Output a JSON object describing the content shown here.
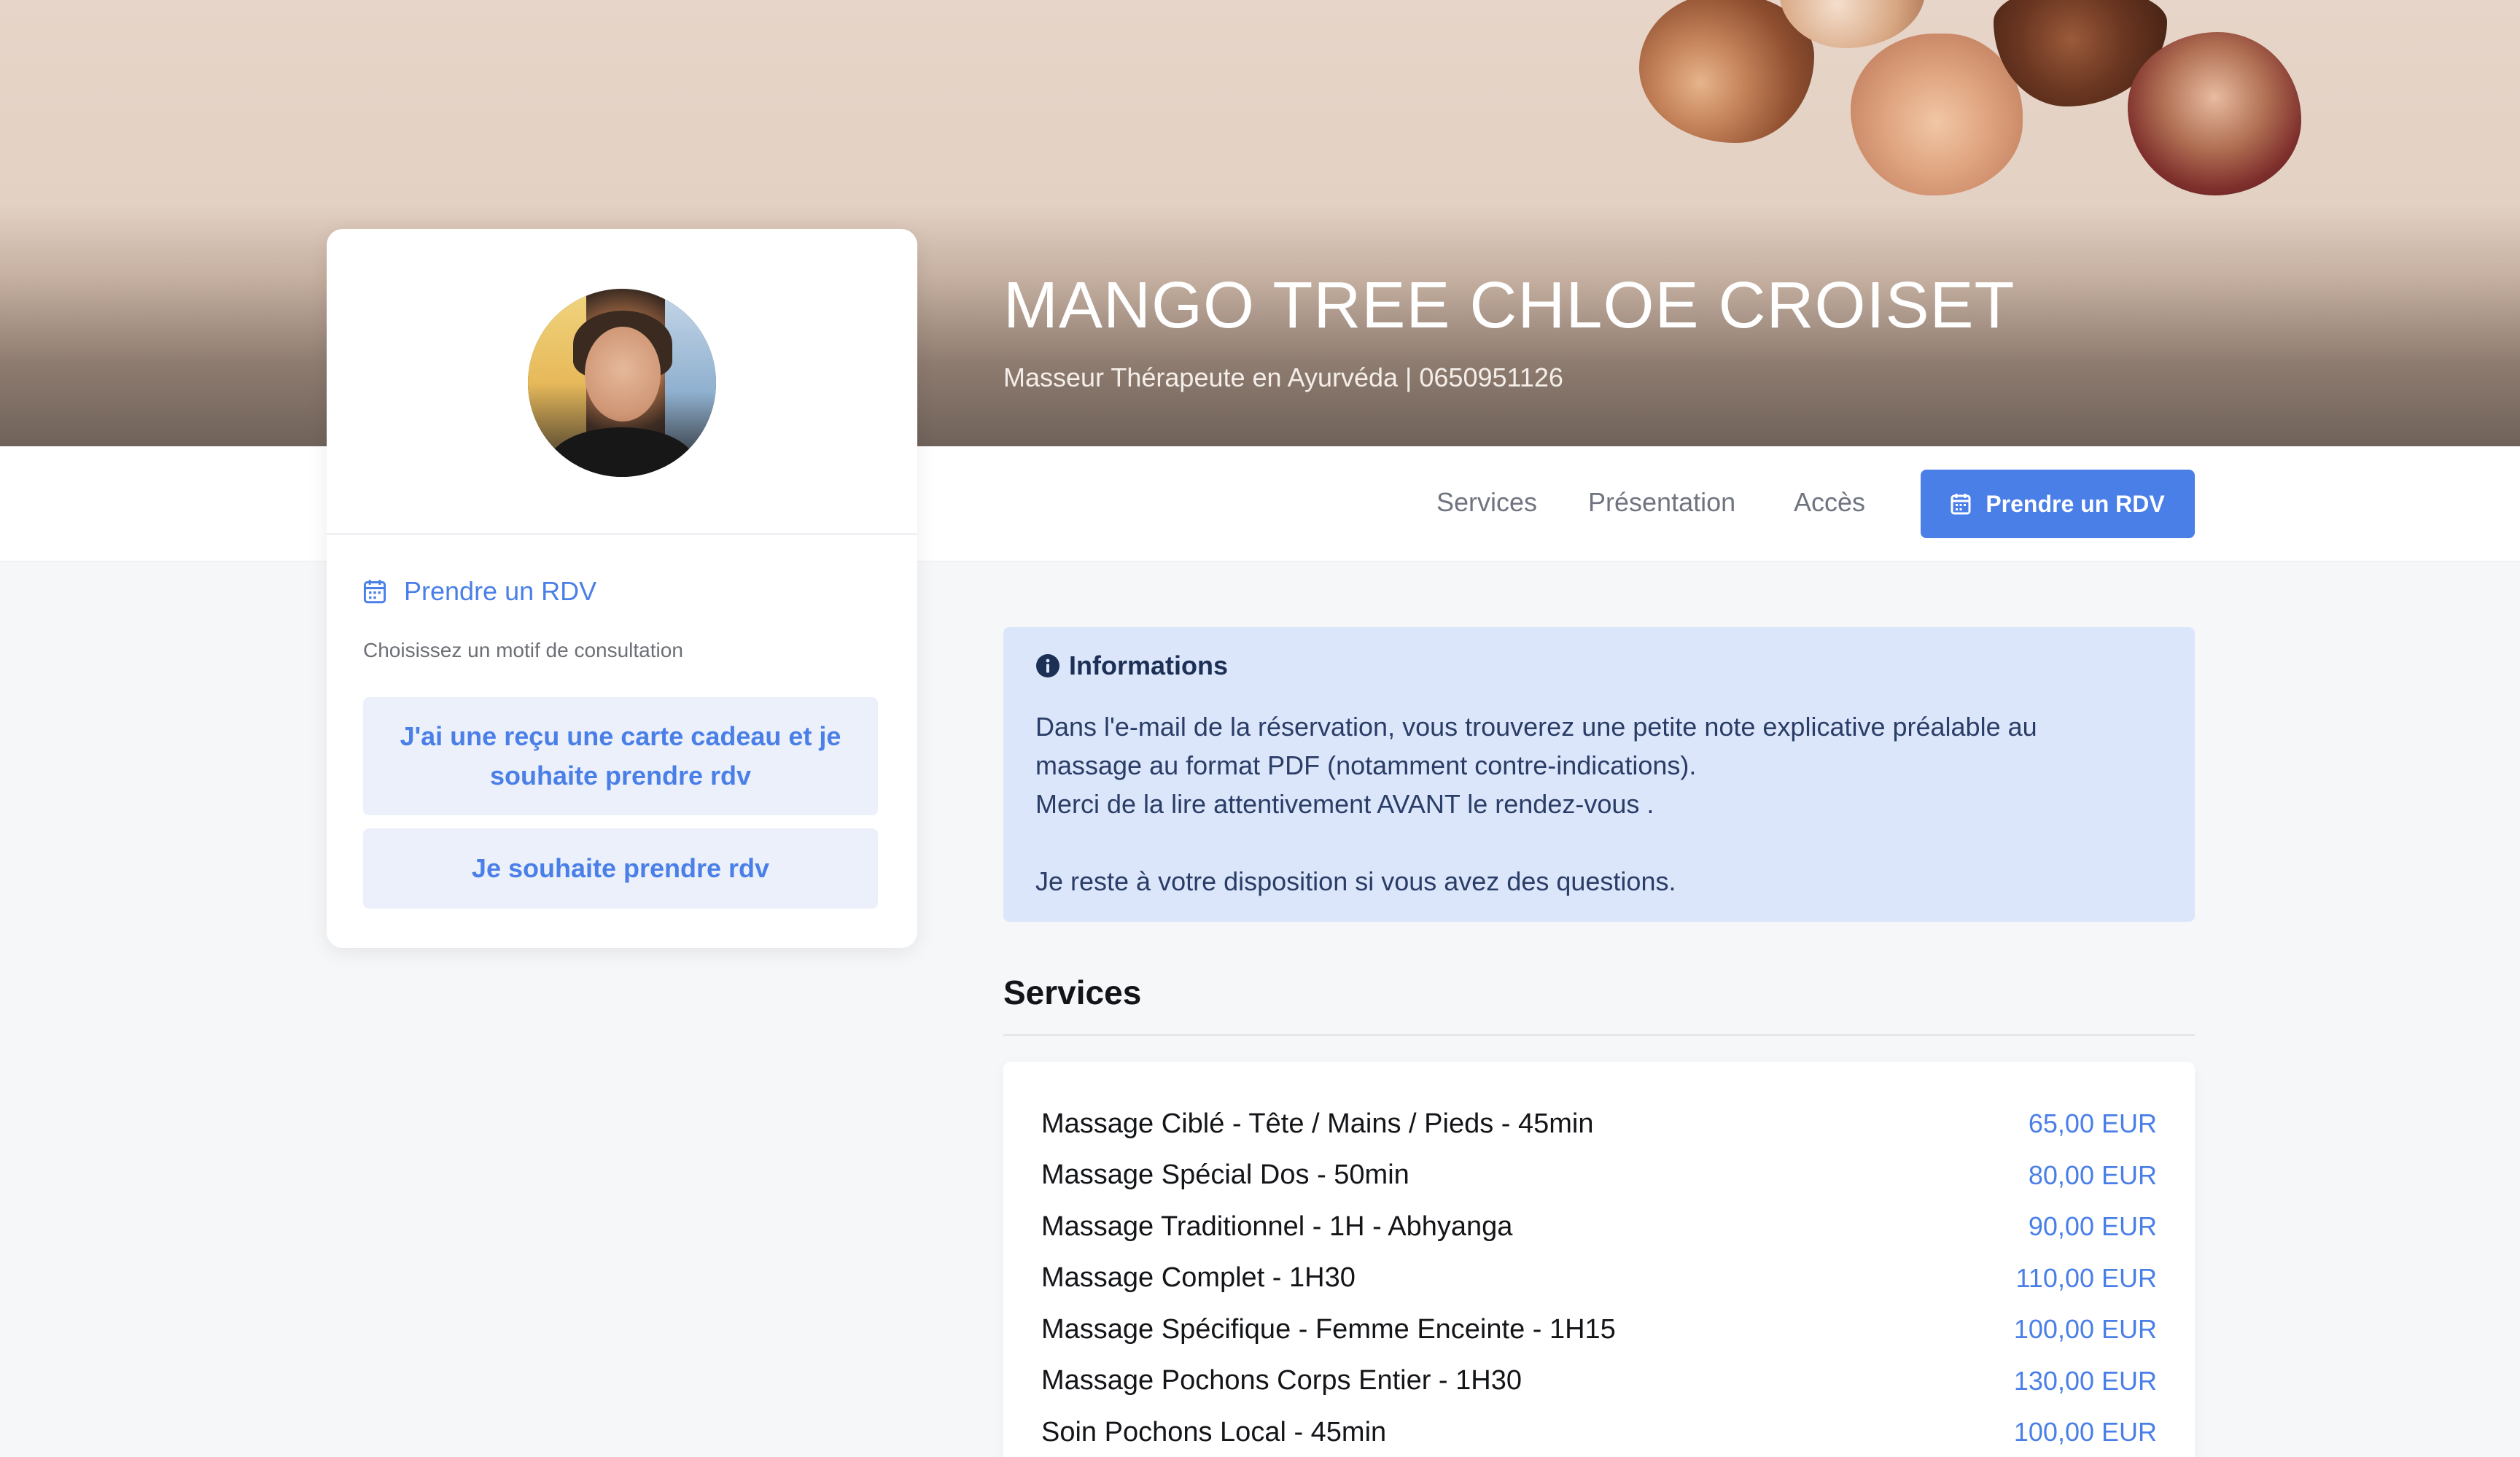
{
  "hero": {
    "title": "MANGO TREE CHLOE CROISET",
    "subtitle": "Masseur Thérapeute en Ayurvéda | 0650951126"
  },
  "nav": {
    "services": "Services",
    "presentation": "Présentation",
    "acces": "Accès",
    "rdv_button": "Prendre un RDV"
  },
  "sidebar": {
    "rdv_link": "Prendre un RDV",
    "hint": "Choisissez un motif de consultation",
    "motifs": [
      "J'ai une reçu une carte cadeau et je souhaite prendre rdv",
      "Je souhaite prendre rdv"
    ]
  },
  "info": {
    "heading": "Informations",
    "line1": "Dans l'e-mail de la réservation, vous trouverez une petite note explicative préalable au",
    "line2": "massage au format PDF (notamment contre-indications).",
    "line3": "Merci de la lire attentivement AVANT le rendez-vous .",
    "line4": "Je reste à votre disposition si vous avez des questions."
  },
  "services": {
    "heading": "Services",
    "items": [
      {
        "name": "Massage Ciblé - Tête / Mains / Pieds - 45min",
        "price": "65,00 EUR"
      },
      {
        "name": "Massage Spécial Dos - 50min",
        "price": "80,00 EUR"
      },
      {
        "name": "Massage Traditionnel - 1H - Abhyanga",
        "price": "90,00 EUR"
      },
      {
        "name": "Massage Complet - 1H30",
        "price": "110,00 EUR"
      },
      {
        "name": "Massage Spécifique - Femme Enceinte - 1H15",
        "price": "100,00 EUR"
      },
      {
        "name": "Massage Pochons Corps Entier - 1H30",
        "price": "130,00 EUR"
      },
      {
        "name": "Soin Pochons Local - 45min",
        "price": "100,00 EUR"
      }
    ]
  },
  "icons": {
    "calendar": "calendar-icon",
    "info": "info-circle-icon"
  },
  "colors": {
    "accent": "#4a7fe8",
    "info_bg": "#dce6fb",
    "hero_top": "#e6d5c8"
  }
}
